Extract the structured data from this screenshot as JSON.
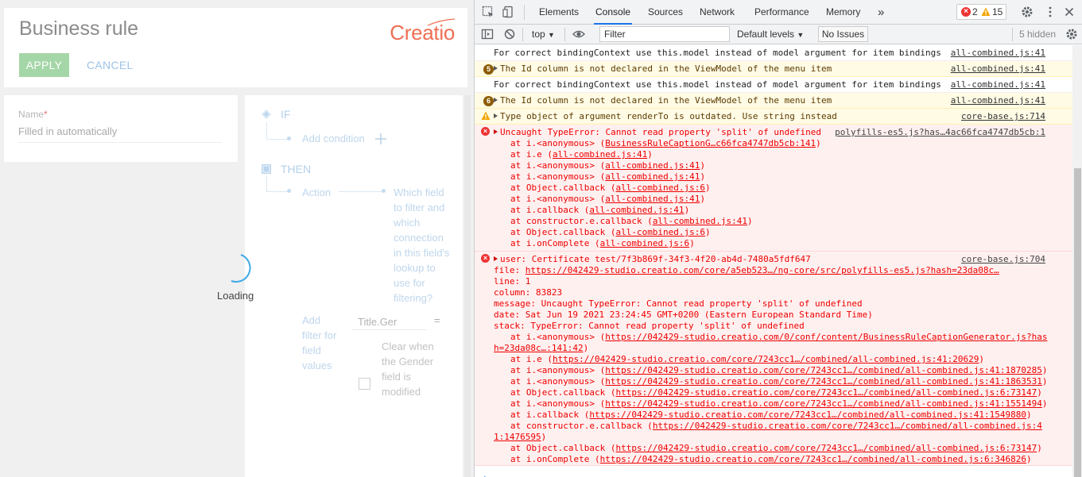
{
  "app": {
    "title": "Business rule",
    "logo": "Creatio",
    "apply_label": "APPLY",
    "cancel_label": "CANCEL",
    "name_label": "Name",
    "name_value": "Filled in automatically",
    "if_label": "IF",
    "add_condition": "Add condition",
    "then_label": "THEN",
    "action_label": "Action",
    "which_field": "Which field to filter and which connection in this field's lookup to use for filtering?",
    "add_filter": "Add filter for field values",
    "title_field": "Title.Ger",
    "equals": "=",
    "clear_when": "Clear when the Gender field is modified",
    "loading": "Loading",
    "colors": {
      "accent": "#f06f54",
      "apply": "#a5d6a7",
      "link": "#9ec3e6"
    }
  },
  "devtools": {
    "tabs": [
      "Elements",
      "Console",
      "Sources",
      "Network",
      "Performance",
      "Memory"
    ],
    "active_tab": "Console",
    "more_tabs": "»",
    "error_count": "2",
    "warning_count": "15",
    "context": "top",
    "filter_placeholder": "Filter",
    "levels": "Default levels",
    "no_issues": "No Issues",
    "hidden": "5 hidden",
    "messages": [
      {
        "type": "plain",
        "text": "For correct bindingContext use this.model instead of model argument for item bindings",
        "src": "all-combined.js:41"
      },
      {
        "type": "warn",
        "count": "5",
        "text": "The Id column is not declared in the ViewModel of the menu item",
        "src": "all-combined.js:41"
      },
      {
        "type": "plain",
        "text": "For correct bindingContext use this.model instead of model argument for item bindings",
        "src": "all-combined.js:41"
      },
      {
        "type": "warn",
        "count": "6",
        "text": "The Id column is not declared in the ViewModel of the menu item",
        "src": "all-combined.js:41"
      },
      {
        "type": "warn",
        "text": "Type object of argument renderTo is outdated. Use string instead",
        "src": "core-base.js:714"
      }
    ],
    "error1": {
      "head": "Uncaught TypeError: Cannot read property 'split' of undefined",
      "src": "polyfills-es5.js?has…4ac66fca4747db5cb:1",
      "stack": [
        [
          "at i.<anonymous> (",
          "BusinessRuleCaptionG…c66fca4747db5cb:141",
          ")"
        ],
        [
          "at i.e (",
          "all-combined.js:41",
          ")"
        ],
        [
          "at i.<anonymous> (",
          "all-combined.js:41",
          ")"
        ],
        [
          "at i.<anonymous> (",
          "all-combined.js:41",
          ")"
        ],
        [
          "at Object.callback (",
          "all-combined.js:6",
          ")"
        ],
        [
          "at i.<anonymous> (",
          "all-combined.js:41",
          ")"
        ],
        [
          "at i.callback (",
          "all-combined.js:41",
          ")"
        ],
        [
          "at constructor.e.callback (",
          "all-combined.js:41",
          ")"
        ],
        [
          "at Object.callback (",
          "all-combined.js:6",
          ")"
        ],
        [
          "at i.onComplete (",
          "all-combined.js:6",
          ")"
        ]
      ]
    },
    "error2": {
      "head": "user: Certificate test/7f3b869f-34f3-4f20-ab4d-7480a5fdf647",
      "src": "core-base.js:704",
      "file_label": "file: ",
      "file_link": "https://042429-studio.creatio.com/core/a5eb523…/ng-core/src/polyfills-es5.js?hash=23da08c…",
      "line": "line: 1",
      "column": "column: 83823",
      "message": "message: Uncaught TypeError: Cannot read property 'split' of undefined",
      "date": "date: Sat Jun 19 2021 23:24:45 GMT+0200 (Eastern European Standard Time)",
      "stack_head": "stack: TypeError: Cannot read property 'split' of undefined",
      "stack1_pre": "at i.<anonymous> (",
      "stack1_link": "https://042429-studio.creatio.com/0/conf/content/BusinessRuleCaptionGenerator.js?has",
      "stack1_cont": "h=23da08c…:141:42",
      "stack1_end": ")",
      "stack": [
        [
          "at i.e (",
          "https://042429-studio.creatio.com/core/7243cc1…/combined/all-combined.js:41:20629",
          ")"
        ],
        [
          "at i.<anonymous> (",
          "https://042429-studio.creatio.com/core/7243cc1…/combined/all-combined.js:41:1870285",
          ")"
        ],
        [
          "at i.<anonymous> (",
          "https://042429-studio.creatio.com/core/7243cc1…/combined/all-combined.js:41:1863531",
          ")"
        ],
        [
          "at Object.callback (",
          "https://042429-studio.creatio.com/core/7243cc1…/combined/all-combined.js:6:73147",
          ")"
        ],
        [
          "at i.<anonymous> (",
          "https://042429-studio.creatio.com/core/7243cc1…/combined/all-combined.js:41:1551494",
          ")"
        ],
        [
          "at i.callback (",
          "https://042429-studio.creatio.com/core/7243cc1…/combined/all-combined.js:41:1549880",
          ")"
        ]
      ],
      "stack_ctor_pre": "at constructor.e.callback (",
      "stack_ctor_link": "https://042429-studio.creatio.com/core/7243cc1…/combined/all-combined.js:4",
      "stack_ctor_cont": "1:1476595",
      "stack_ctor_end": ")",
      "stack_tail": [
        [
          "at Object.callback (",
          "https://042429-studio.creatio.com/core/7243cc1…/combined/all-combined.js:6:73147",
          ")"
        ],
        [
          "at i.onComplete (",
          "https://042429-studio.creatio.com/core/7243cc1…/combined/all-combined.js:6:346826",
          ")"
        ]
      ]
    },
    "prompt": "›"
  }
}
